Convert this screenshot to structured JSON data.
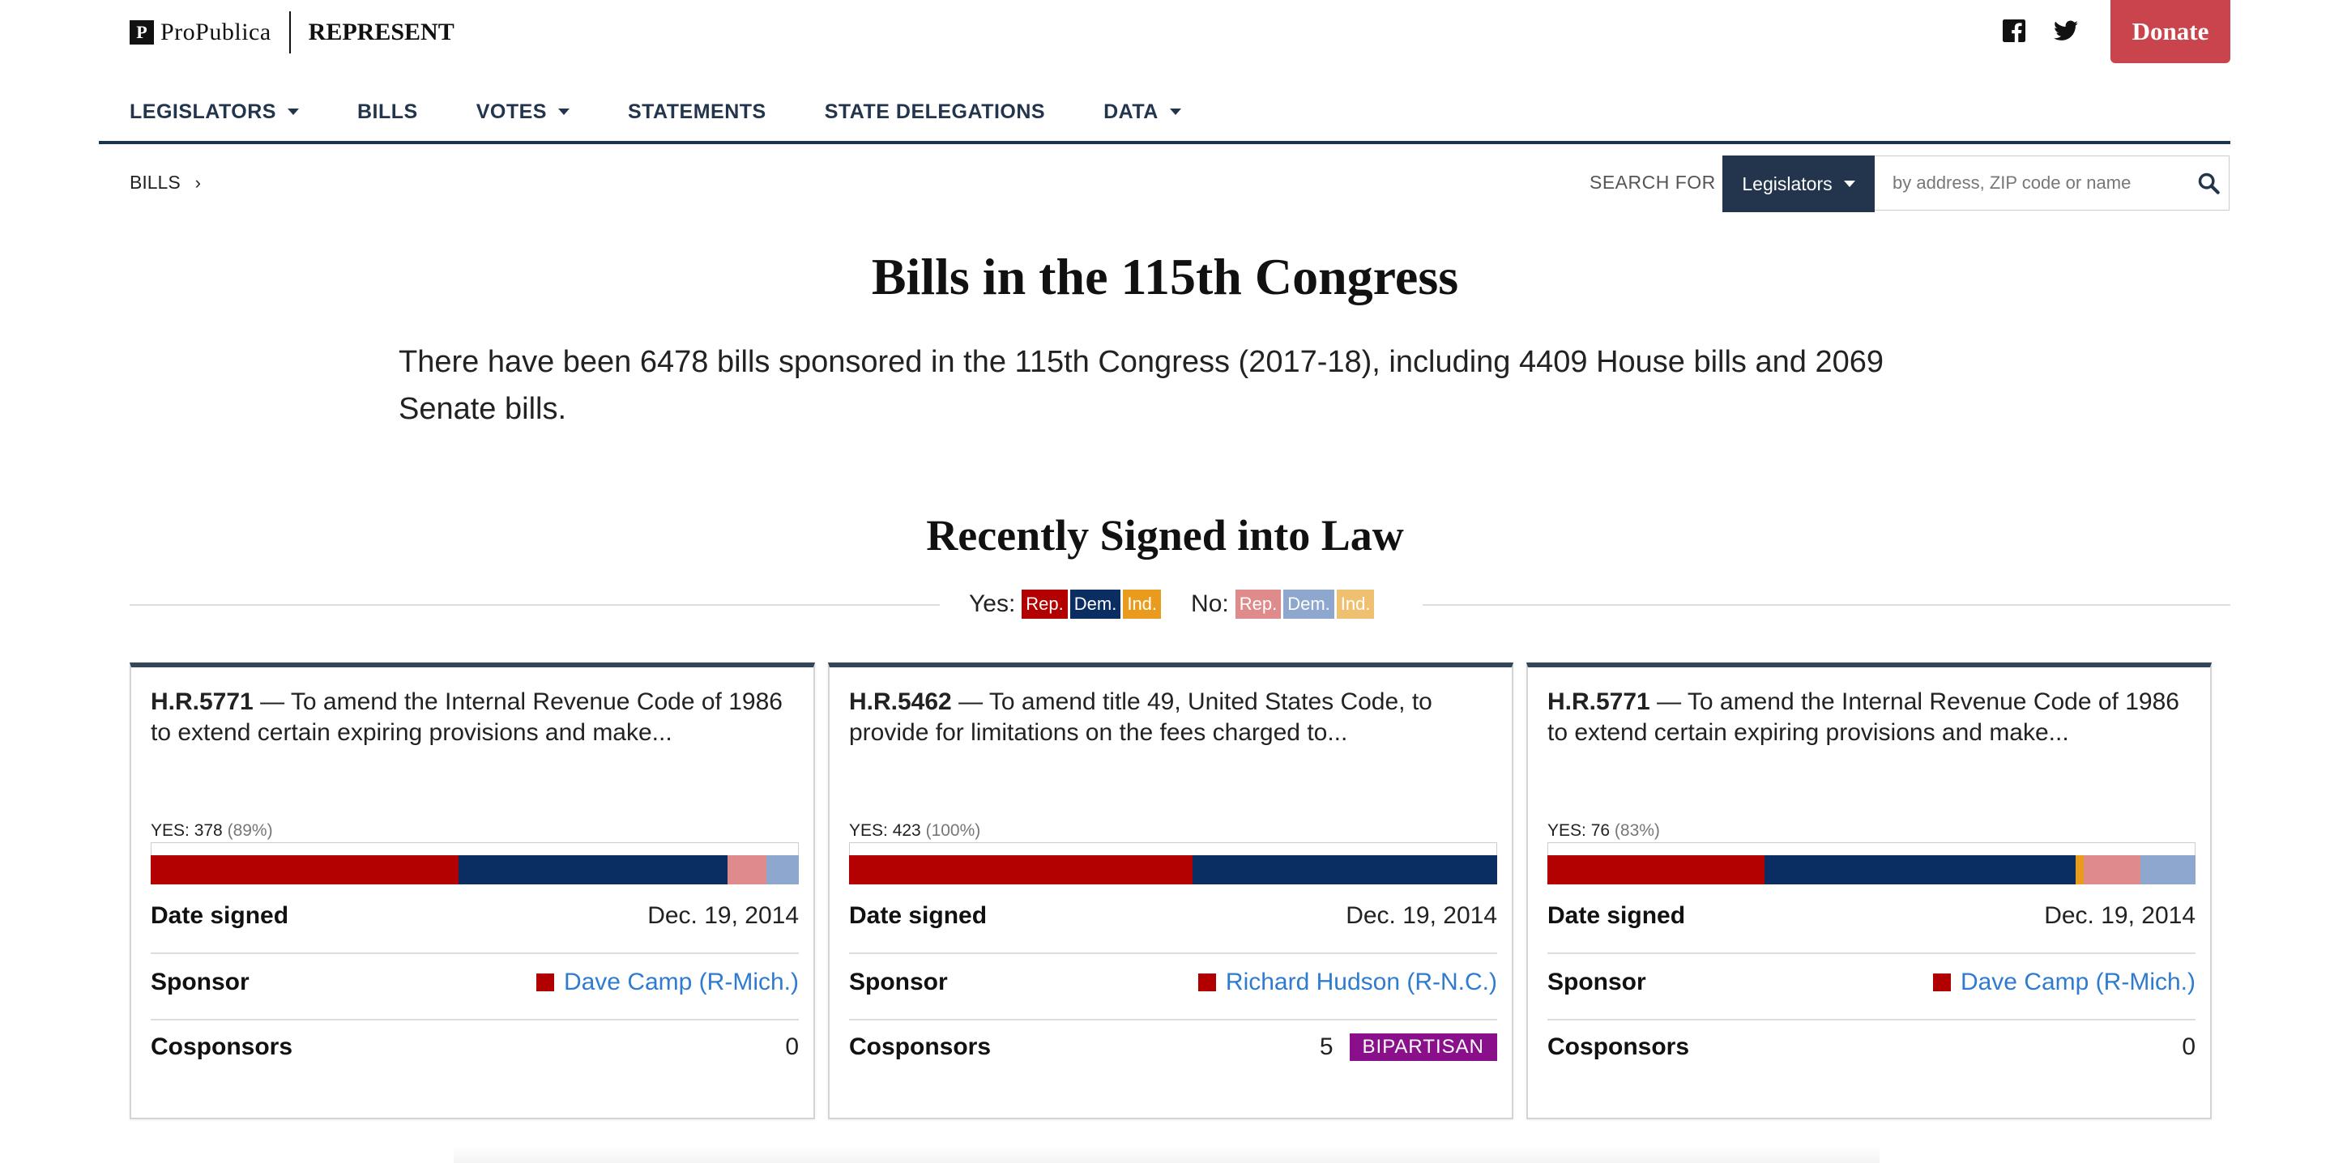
{
  "brand": {
    "logo_mark": "P",
    "logo_text": "ProPublica",
    "app_name": "REPRESENT"
  },
  "social": {
    "facebook_icon": "facebook-icon",
    "twitter_icon": "twitter-icon"
  },
  "donate_label": "Donate",
  "nav": [
    {
      "label": "LEGISLATORS",
      "dropdown": true
    },
    {
      "label": "BILLS",
      "dropdown": false
    },
    {
      "label": "VOTES",
      "dropdown": true
    },
    {
      "label": "STATEMENTS",
      "dropdown": false
    },
    {
      "label": "STATE DELEGATIONS",
      "dropdown": false
    },
    {
      "label": "DATA",
      "dropdown": true
    }
  ],
  "breadcrumb": {
    "item": "BILLS",
    "separator": "›"
  },
  "search": {
    "label": "SEARCH FOR",
    "select_value": "Legislators",
    "placeholder": "by address, ZIP code or name"
  },
  "page_title": "Bills in the 115th Congress",
  "intro": "There have been 6478 bills sponsored in the 115th Congress (2017-18), including 4409 House bills and 2069 Senate bills.",
  "section_title": "Recently Signed into Law",
  "legend": {
    "yes_label": "Yes:",
    "no_label": "No:",
    "yes_swatches": [
      {
        "label": "Rep.",
        "color": "#b30000"
      },
      {
        "label": "Dem.",
        "color": "#0a2d62"
      },
      {
        "label": "Ind.",
        "color": "#e89b1c"
      }
    ],
    "no_swatches": [
      {
        "label": "Rep.",
        "color": "#e08b8b"
      },
      {
        "label": "Dem.",
        "color": "#8ea7cf"
      },
      {
        "label": "Ind.",
        "color": "#efc06f"
      }
    ]
  },
  "cards": [
    {
      "bill": "H.R.5771",
      "desc": " — To amend the Internal Revenue Code of 1986 to extend certain expiring provisions and make...",
      "yes_text": "YES: 378",
      "yes_pct": "(89%)",
      "vote_fractions": {
        "yes_rep": 0.475,
        "yes_dem": 0.415,
        "yes_ind": 0,
        "no_rep": 0.06,
        "no_dem": 0.05,
        "no_ind": 0
      },
      "date_label": "Date signed",
      "date_value": "Dec. 19, 2014",
      "sponsor_label": "Sponsor",
      "sponsor_name": "Dave Camp (R-Mich.)",
      "cosponsors_label": "Cosponsors",
      "cosponsors_value": "0",
      "bipartisan": ""
    },
    {
      "bill": "H.R.5462",
      "desc": " — To amend title 49, United States Code, to provide for limitations on the fees charged to...",
      "yes_text": "YES: 423",
      "yes_pct": "(100%)",
      "vote_fractions": {
        "yes_rep": 0.53,
        "yes_dem": 0.47,
        "yes_ind": 0,
        "no_rep": 0,
        "no_dem": 0,
        "no_ind": 0
      },
      "date_label": "Date signed",
      "date_value": "Dec. 19, 2014",
      "sponsor_label": "Sponsor",
      "sponsor_name": "Richard Hudson (R-N.C.)",
      "cosponsors_label": "Cosponsors",
      "cosponsors_value": "5",
      "bipartisan": "BIPARTISAN"
    },
    {
      "bill": "H.R.5771",
      "desc": " — To amend the Internal Revenue Code of 1986 to extend certain expiring provisions and make...",
      "yes_text": "YES: 76",
      "yes_pct": "(83%)",
      "vote_fractions": {
        "yes_rep": 0.335,
        "yes_dem": 0.48,
        "yes_ind": 0.012,
        "no_rep": 0.088,
        "no_dem": 0.085,
        "no_ind": 0
      },
      "date_label": "Date signed",
      "date_value": "Dec. 19, 2014",
      "sponsor_label": "Sponsor",
      "sponsor_name": "Dave Camp (R-Mich.)",
      "cosponsors_label": "Cosponsors",
      "cosponsors_value": "0",
      "bipartisan": ""
    }
  ]
}
